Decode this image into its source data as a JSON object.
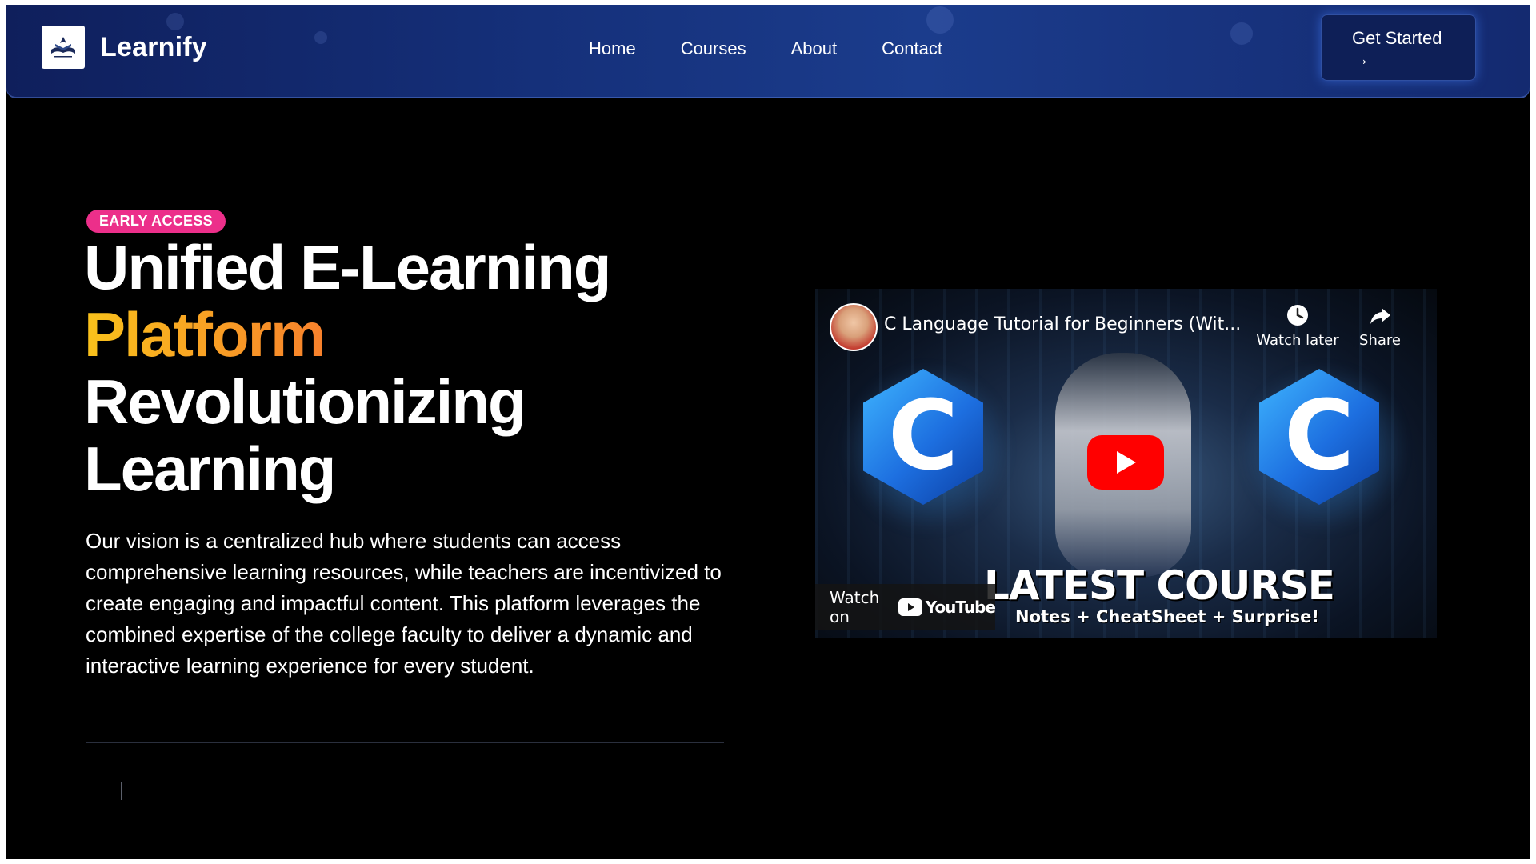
{
  "nav": {
    "brand": "Learnify",
    "links": [
      "Home",
      "Courses",
      "About",
      "Contact"
    ],
    "cta_label": "Get Started",
    "cta_arrow": "→"
  },
  "hero": {
    "badge": "EARLY ACCESS",
    "headline_line1": "Unified E-Learning",
    "headline_line2": "Platform",
    "headline_line3": "Revolutionizing",
    "headline_line4": "Learning",
    "description": "Our vision is a centralized hub where students can access comprehensive learning resources, while teachers are incentivized to create engaging and impactful content. This platform leverages the combined expertise of the college faculty to deliver a dynamic and interactive learning experience for every student."
  },
  "video": {
    "title": "C Language Tutorial for Beginners (Wit...",
    "watch_later": "Watch later",
    "share": "Share",
    "thumbnail_letter": "C",
    "thumbnail_headline": "LATEST COURSE",
    "thumbnail_subline": "Notes + CheatSheet + Surprise!",
    "watch_on": "Watch on",
    "youtube_word": "YouTube"
  },
  "colors": {
    "badge": "#ec2f8a",
    "accent_gradient_start": "#f9c21b",
    "accent_gradient_end": "#ee3a8c",
    "nav_bg": "#15307a",
    "youtube_red": "#ff0000"
  },
  "icons": {
    "logo": "book-logo-icon",
    "cta_arrow": "arrow-right-icon",
    "watch_later": "clock-icon",
    "share": "share-arrow-icon",
    "play": "play-icon",
    "youtube": "youtube-logo-icon"
  }
}
